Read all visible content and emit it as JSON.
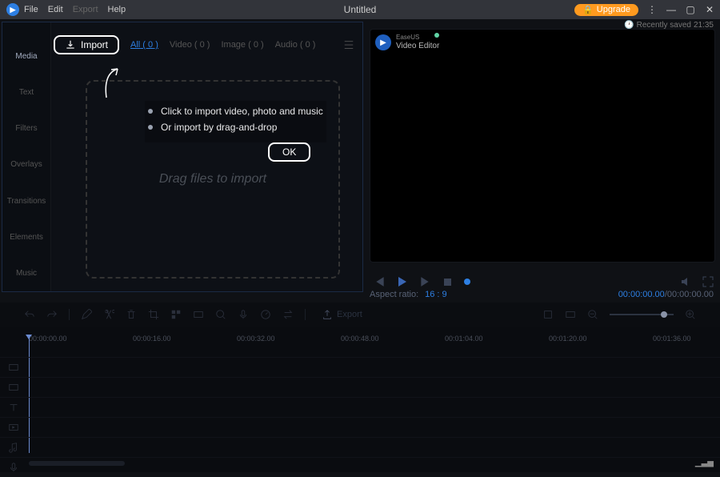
{
  "titlebar": {
    "menu": [
      "File",
      "Edit",
      "Export",
      "Help"
    ],
    "title": "Untitled",
    "upgrade": "Upgrade",
    "saved_prefix": "Recently saved",
    "saved_time": "21:35"
  },
  "side_tabs": [
    "Media",
    "Text",
    "Filters",
    "Overlays",
    "Transitions",
    "Elements",
    "Music"
  ],
  "media": {
    "import_label": "Import",
    "tabs": [
      {
        "label": "All",
        "count": 0
      },
      {
        "label": "Video",
        "count": 0
      },
      {
        "label": "Image",
        "count": 0
      },
      {
        "label": "Audio",
        "count": 0
      }
    ],
    "drop_text": "Drag files to import",
    "tips": [
      "Click to import video, photo and music",
      "Or import by drag-and-drop"
    ],
    "ok_label": "OK"
  },
  "preview": {
    "brand_small": "EaseUS",
    "brand_large": "Video Editor"
  },
  "player": {
    "aspect_label": "Aspect ratio:",
    "aspect_value": "16 : 9",
    "current_time": "00:00:00.00",
    "sep": " / ",
    "total_time": "00:00:00.00"
  },
  "toolbar": {
    "export_label": "Export"
  },
  "ruler": {
    "ticks": [
      "00:00:00.00",
      "00:00:16.00",
      "00:00:32.00",
      "00:00:48.00",
      "00:01:04.00",
      "00:01:20.00",
      "00:01:36.00"
    ]
  }
}
